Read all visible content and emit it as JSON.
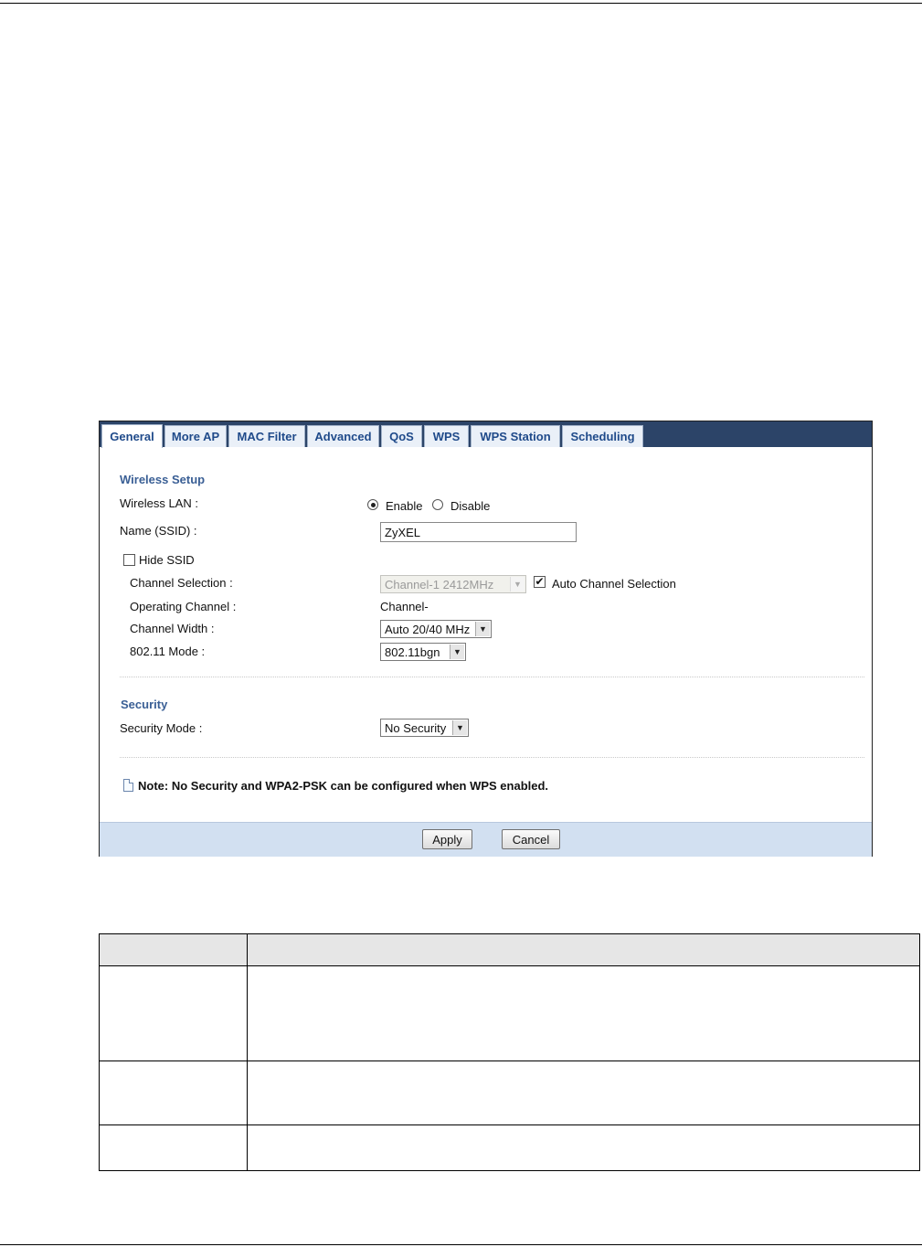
{
  "tabs": [
    {
      "label": "General",
      "active": true
    },
    {
      "label": "More AP",
      "active": false
    },
    {
      "label": "MAC Filter",
      "active": false
    },
    {
      "label": "Advanced",
      "active": false
    },
    {
      "label": "QoS",
      "active": false
    },
    {
      "label": "WPS",
      "active": false
    },
    {
      "label": "WPS Station",
      "active": false
    },
    {
      "label": "Scheduling",
      "active": false
    }
  ],
  "wireless_setup": {
    "title": "Wireless Setup",
    "wireless_lan_label": "Wireless LAN :",
    "enable_label": "Enable",
    "disable_label": "Disable",
    "wireless_lan_value": "Enable",
    "ssid_label": "Name (SSID) :",
    "ssid_value": "ZyXEL",
    "hide_ssid_label": "Hide SSID",
    "hide_ssid_checked": false,
    "channel_selection_label": "Channel Selection :",
    "channel_selection_value": "Channel-1 2412MHz",
    "auto_channel_label": "Auto Channel Selection",
    "auto_channel_checked": true,
    "operating_channel_label": "Operating Channel :",
    "operating_channel_value": "Channel-",
    "channel_width_label": "Channel Width :",
    "channel_width_value": "Auto 20/40 MHz",
    "mode_label": "802.11 Mode :",
    "mode_value": "802.11bgn"
  },
  "security": {
    "title": "Security",
    "mode_label": "Security Mode :",
    "mode_value": "No Security"
  },
  "note": "Note: No Security and WPA2-PSK can be configured when WPS enabled.",
  "buttons": {
    "apply": "Apply",
    "cancel": "Cancel"
  },
  "colors": {
    "tab_bar": "#2c4468",
    "section_title": "#3a5f95",
    "footer": "#d2e0f1",
    "table_header": "#e6e6e6"
  }
}
